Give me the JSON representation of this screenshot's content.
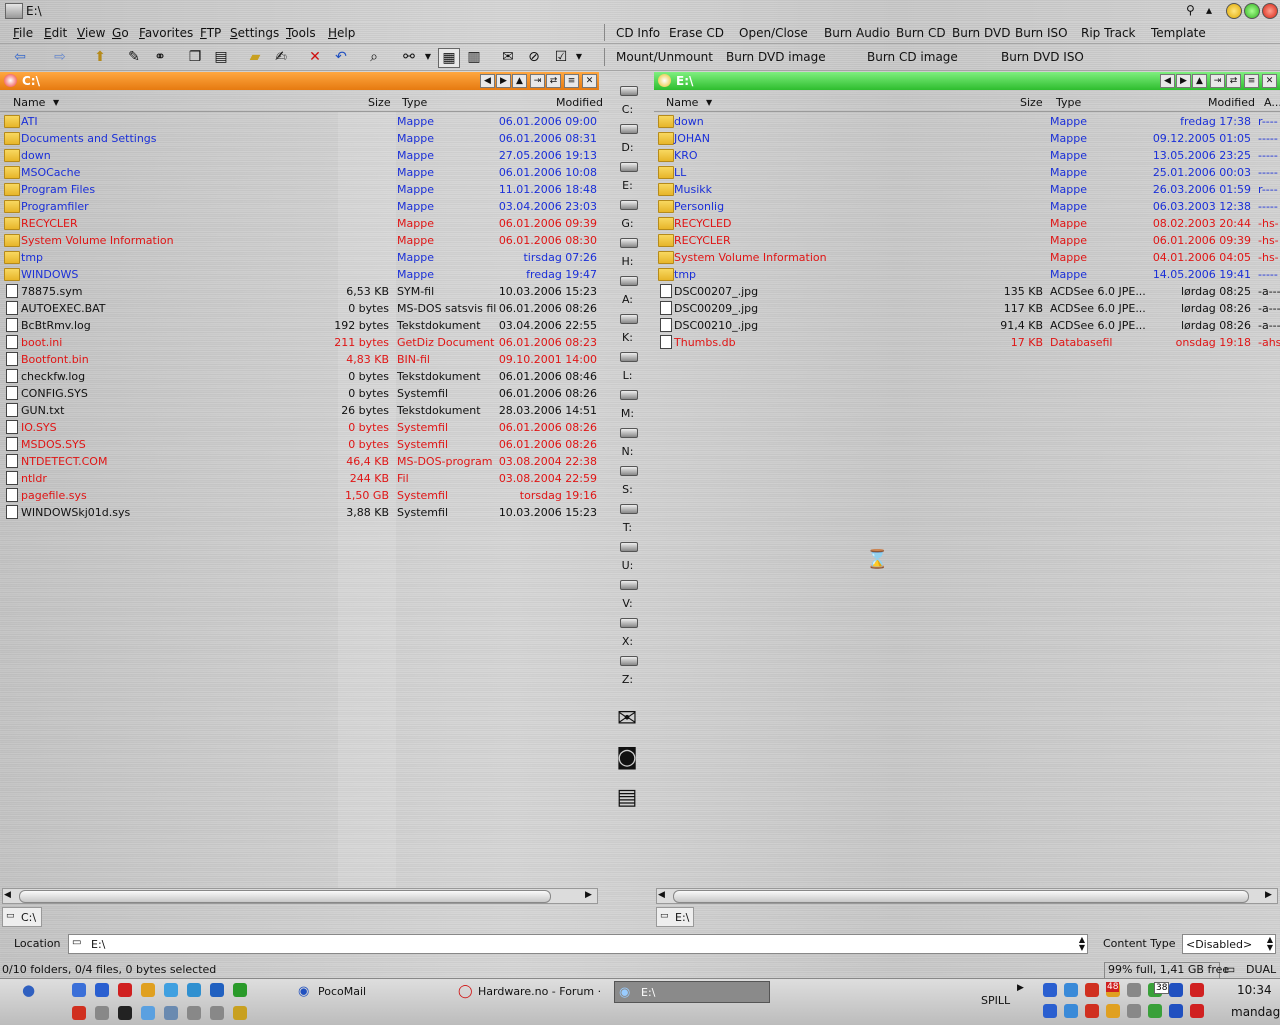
{
  "window": {
    "title": "E:\\"
  },
  "menu": {
    "file": "File",
    "edit": "Edit",
    "view": "View",
    "go": "Go",
    "favorites": "Favorites",
    "ftp": "FTP",
    "settings": "Settings",
    "tools": "Tools",
    "help": "Help"
  },
  "cd_toolbar": {
    "row1": [
      "CD Info",
      "Erase CD",
      "Open/Close",
      "Burn Audio",
      "Burn CD",
      "Burn DVD",
      "Burn ISO",
      "Rip Track",
      "Template"
    ],
    "row2": [
      "Mount/Unmount",
      "Burn DVD image",
      "Burn CD image",
      "Burn DVD ISO"
    ]
  },
  "left_panel": {
    "path": "C:\\",
    "columns": {
      "name": "Name",
      "size": "Size",
      "type": "Type",
      "modified": "Modified"
    },
    "tab": "C:\\",
    "rows": [
      {
        "name": "ATI",
        "size": "",
        "type": "Mappe",
        "modified": "06.01.2006 09:00",
        "kind": "folder",
        "color": "blue"
      },
      {
        "name": "Documents and Settings",
        "size": "",
        "type": "Mappe",
        "modified": "06.01.2006 08:31",
        "kind": "folder",
        "color": "blue"
      },
      {
        "name": "down",
        "size": "",
        "type": "Mappe",
        "modified": "27.05.2006 19:13",
        "kind": "folder",
        "color": "blue"
      },
      {
        "name": "MSOCache",
        "size": "",
        "type": "Mappe",
        "modified": "06.01.2006 10:08",
        "kind": "folder",
        "color": "blue"
      },
      {
        "name": "Program Files",
        "size": "",
        "type": "Mappe",
        "modified": "11.01.2006 18:48",
        "kind": "folder",
        "color": "blue"
      },
      {
        "name": "Programfiler",
        "size": "",
        "type": "Mappe",
        "modified": "03.04.2006 23:03",
        "kind": "folder",
        "color": "blue"
      },
      {
        "name": "RECYCLER",
        "size": "",
        "type": "Mappe",
        "modified": "06.01.2006 09:39",
        "kind": "folder",
        "color": "red"
      },
      {
        "name": "System Volume Information",
        "size": "",
        "type": "Mappe",
        "modified": "06.01.2006 08:30",
        "kind": "folder",
        "color": "red"
      },
      {
        "name": "tmp",
        "size": "",
        "type": "Mappe",
        "modified": "tirsdag 07:26",
        "kind": "folder",
        "color": "blue"
      },
      {
        "name": "WINDOWS",
        "size": "",
        "type": "Mappe",
        "modified": "fredag 19:47",
        "kind": "folder",
        "color": "blue"
      },
      {
        "name": "78875.sym",
        "size": "6,53 KB",
        "type": "SYM-fil",
        "modified": "10.03.2006 15:23",
        "kind": "file",
        "color": "blk"
      },
      {
        "name": "AUTOEXEC.BAT",
        "size": "0 bytes",
        "type": "MS-DOS satsvis fil",
        "modified": "06.01.2006 08:26",
        "kind": "file",
        "color": "blk"
      },
      {
        "name": "BcBtRmv.log",
        "size": "192 bytes",
        "type": "Tekstdokument",
        "modified": "03.04.2006 22:55",
        "kind": "file",
        "color": "blk"
      },
      {
        "name": "boot.ini",
        "size": "211 bytes",
        "type": "GetDiz Document",
        "modified": "06.01.2006 08:23",
        "kind": "file",
        "color": "red"
      },
      {
        "name": "Bootfont.bin",
        "size": "4,83 KB",
        "type": "BIN-fil",
        "modified": "09.10.2001 14:00",
        "kind": "file",
        "color": "red"
      },
      {
        "name": "checkfw.log",
        "size": "0 bytes",
        "type": "Tekstdokument",
        "modified": "06.01.2006 08:46",
        "kind": "file",
        "color": "blk"
      },
      {
        "name": "CONFIG.SYS",
        "size": "0 bytes",
        "type": "Systemfil",
        "modified": "06.01.2006 08:26",
        "kind": "file",
        "color": "blk"
      },
      {
        "name": "GUN.txt",
        "size": "26 bytes",
        "type": "Tekstdokument",
        "modified": "28.03.2006 14:51",
        "kind": "file",
        "color": "blk"
      },
      {
        "name": "IO.SYS",
        "size": "0 bytes",
        "type": "Systemfil",
        "modified": "06.01.2006 08:26",
        "kind": "file",
        "color": "red"
      },
      {
        "name": "MSDOS.SYS",
        "size": "0 bytes",
        "type": "Systemfil",
        "modified": "06.01.2006 08:26",
        "kind": "file",
        "color": "red"
      },
      {
        "name": "NTDETECT.COM",
        "size": "46,4 KB",
        "type": "MS-DOS-program",
        "modified": "03.08.2004 22:38",
        "kind": "file",
        "color": "red"
      },
      {
        "name": "ntldr",
        "size": "244 KB",
        "type": "Fil",
        "modified": "03.08.2004 22:59",
        "kind": "file",
        "color": "red"
      },
      {
        "name": "pagefile.sys",
        "size": "1,50 GB",
        "type": "Systemfil",
        "modified": "torsdag 19:16",
        "kind": "file",
        "color": "red"
      },
      {
        "name": "WINDOWSkj01d.sys",
        "size": "3,88 KB",
        "type": "Systemfil",
        "modified": "10.03.2006 15:23",
        "kind": "file",
        "color": "blk"
      }
    ]
  },
  "right_panel": {
    "path": "E:\\",
    "columns": {
      "name": "Name",
      "size": "Size",
      "type": "Type",
      "modified": "Modified",
      "attr": "A..."
    },
    "tab": "E:\\",
    "rows": [
      {
        "name": "down",
        "size": "",
        "type": "Mappe",
        "modified": "fredag 17:38",
        "attr": "r----",
        "kind": "folder",
        "color": "blue"
      },
      {
        "name": "JOHAN",
        "size": "",
        "type": "Mappe",
        "modified": "09.12.2005 01:05",
        "attr": "-----",
        "kind": "folder",
        "color": "blue"
      },
      {
        "name": "KRO",
        "size": "",
        "type": "Mappe",
        "modified": "13.05.2006 23:25",
        "attr": "-----",
        "kind": "folder",
        "color": "blue"
      },
      {
        "name": "LL",
        "size": "",
        "type": "Mappe",
        "modified": "25.01.2006 00:03",
        "attr": "-----",
        "kind": "folder",
        "color": "blue"
      },
      {
        "name": "Musikk",
        "size": "",
        "type": "Mappe",
        "modified": "26.03.2006 01:59",
        "attr": "r----",
        "kind": "folder",
        "color": "blue"
      },
      {
        "name": "Personlig",
        "size": "",
        "type": "Mappe",
        "modified": "06.03.2003 12:38",
        "attr": "-----",
        "kind": "folder",
        "color": "blue"
      },
      {
        "name": "RECYCLED",
        "size": "",
        "type": "Mappe",
        "modified": "08.02.2003 20:44",
        "attr": "-hs-",
        "kind": "folder",
        "color": "red"
      },
      {
        "name": "RECYCLER",
        "size": "",
        "type": "Mappe",
        "modified": "06.01.2006 09:39",
        "attr": "-hs-",
        "kind": "folder",
        "color": "red"
      },
      {
        "name": "System Volume Information",
        "size": "",
        "type": "Mappe",
        "modified": "04.01.2006 04:05",
        "attr": "-hs-",
        "kind": "folder",
        "color": "red"
      },
      {
        "name": "tmp",
        "size": "",
        "type": "Mappe",
        "modified": "14.05.2006 19:41",
        "attr": "-----",
        "kind": "folder",
        "color": "blue"
      },
      {
        "name": "DSC00207_.jpg",
        "size": "135 KB",
        "type": "ACDSee 6.0 JPE...",
        "modified": "lørdag 08:25",
        "attr": "-a---",
        "kind": "file",
        "color": "blk"
      },
      {
        "name": "DSC00209_.jpg",
        "size": "117 KB",
        "type": "ACDSee 6.0 JPE...",
        "modified": "lørdag 08:26",
        "attr": "-a---",
        "kind": "file",
        "color": "blk"
      },
      {
        "name": "DSC00210_.jpg",
        "size": "91,4 KB",
        "type": "ACDSee 6.0 JPE...",
        "modified": "lørdag 08:26",
        "attr": "-a---",
        "kind": "file",
        "color": "blk"
      },
      {
        "name": "Thumbs.db",
        "size": "17 KB",
        "type": "Databasefil",
        "modified": "onsdag 19:18",
        "attr": "-ahs",
        "kind": "file",
        "color": "red"
      }
    ]
  },
  "drives": [
    "C:",
    "D:",
    "E:",
    "G:",
    "H:",
    "A:",
    "K:",
    "L:",
    "M:",
    "N:",
    "S:",
    "T:",
    "U:",
    "V:",
    "X:",
    "Z:"
  ],
  "location": {
    "label": "Location",
    "value": "E:\\",
    "content_type_label": "Content Type",
    "content_type_value": "<Disabled>"
  },
  "status": {
    "left": "0/10 folders, 0/4 files, 0 bytes selected",
    "disk": "99% full, 1,41 GB free",
    "mode": "DUAL"
  },
  "taskbar": {
    "tasks": [
      "PocoMail",
      "Hardware.no - Forum ·",
      "E:\\"
    ],
    "spill": "SPILL",
    "clock": "10:34",
    "day": "mandag",
    "tray_numbers": [
      "48",
      "38"
    ]
  },
  "colors": {
    "left_header": "#f08a1a",
    "right_header": "#3fcf3f",
    "blue_text": "#1a2fd8",
    "red_text": "#e01515"
  }
}
